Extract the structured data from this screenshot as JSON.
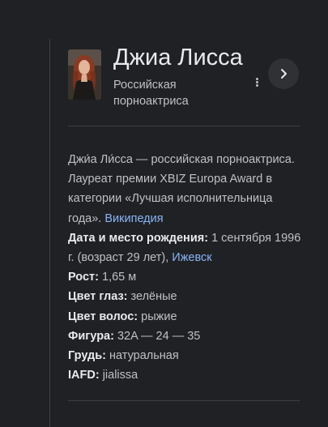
{
  "entity": {
    "title": "Джиа Лисса",
    "subtitle": "Российская порноактриса",
    "more_options_icon": "three-dots-vertical-icon",
    "next_icon": "chevron-right-icon"
  },
  "description": {
    "text": "Джи́а Ли́сса — российская порноактриса. Лауреат премии XBIZ Europa Award в категории «Лучшая исполнительница года».",
    "source_link": "Википедия"
  },
  "facts": {
    "birth": {
      "label": "Дата и место рождения:",
      "value": "1 сентября 1996 г. (возраст 29 лет),",
      "link": "Ижевск"
    },
    "height": {
      "label": "Рост:",
      "value": "1,65 м"
    },
    "eyes": {
      "label": "Цвет глаз:",
      "value": "зелёные"
    },
    "hair": {
      "label": "Цвет волос:",
      "value": "рыжие"
    },
    "figure": {
      "label": "Фигура:",
      "value": "32A — 24 — 35"
    },
    "breasts": {
      "label": "Грудь:",
      "value": "натуральная"
    },
    "iafd": {
      "label": "IAFD:",
      "value": "jialissa"
    }
  },
  "colors": {
    "background": "#202124",
    "title": "#e8eaed",
    "text": "#bdc1c6",
    "link": "#8ab4f8",
    "button": "#303134"
  }
}
